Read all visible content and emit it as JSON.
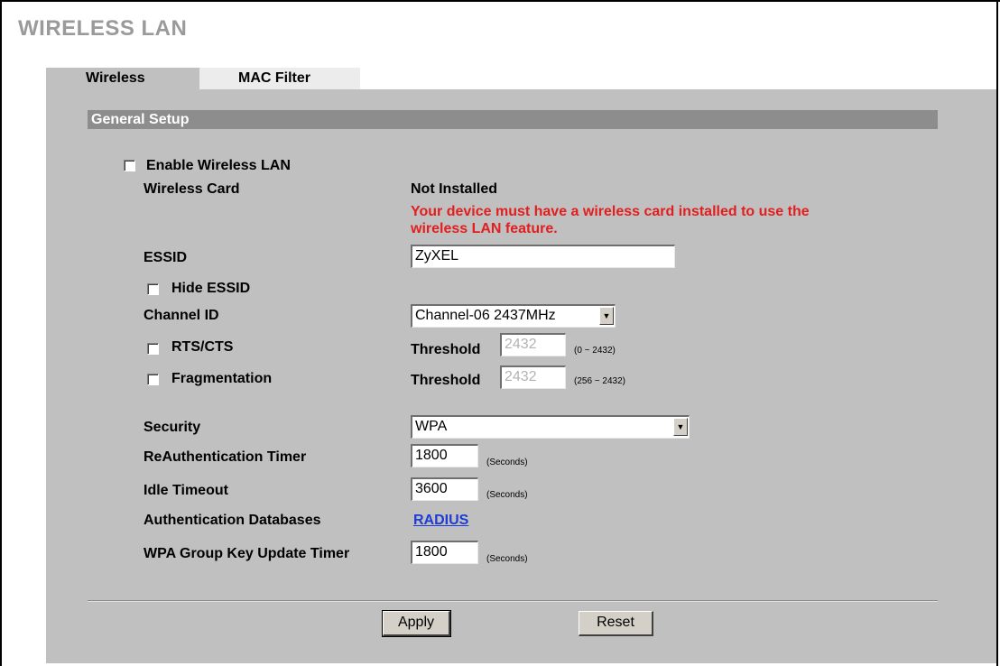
{
  "page": {
    "title": "WIRELESS LAN"
  },
  "tabs": [
    {
      "label": "Wireless",
      "active": true
    },
    {
      "label": "MAC Filter",
      "active": false
    }
  ],
  "section": {
    "title": "General Setup"
  },
  "form": {
    "enable_wireless": {
      "label": "Enable Wireless LAN",
      "checked": false
    },
    "wireless_card": {
      "label": "Wireless Card",
      "value": "Not Installed",
      "warning_line1": "Your device must have a wireless card installed to use the",
      "warning_line2": "wireless LAN feature."
    },
    "essid": {
      "label": "ESSID",
      "value": "ZyXEL"
    },
    "hide_essid": {
      "label": "Hide ESSID",
      "checked": false
    },
    "channel_id": {
      "label": "Channel ID",
      "value": "Channel-06 2437MHz"
    },
    "rts_cts": {
      "label": "RTS/CTS",
      "checked": false,
      "threshold_label": "Threshold",
      "threshold_value": "2432",
      "range": "(0 ~ 2432)"
    },
    "fragmentation": {
      "label": "Fragmentation",
      "checked": false,
      "threshold_label": "Threshold",
      "threshold_value": "2432",
      "range": "(256 ~ 2432)"
    },
    "security": {
      "label": "Security",
      "value": "WPA"
    },
    "reauth_timer": {
      "label": "ReAuthentication Timer",
      "value": "1800",
      "unit": "(Seconds)"
    },
    "idle_timeout": {
      "label": "Idle Timeout",
      "value": "3600",
      "unit": "(Seconds)"
    },
    "auth_databases": {
      "label": "Authentication Databases",
      "link": "RADIUS"
    },
    "wpa_group_key": {
      "label": "WPA Group Key Update Timer",
      "value": "1800",
      "unit": "(Seconds)"
    }
  },
  "buttons": {
    "apply": "Apply",
    "reset": "Reset"
  },
  "colors": {
    "panel": "#c0c0c0",
    "section_bar": "#8d8d8d",
    "warning": "#e21e1e",
    "link": "#1f3bd6",
    "title": "#9a9a9a"
  }
}
